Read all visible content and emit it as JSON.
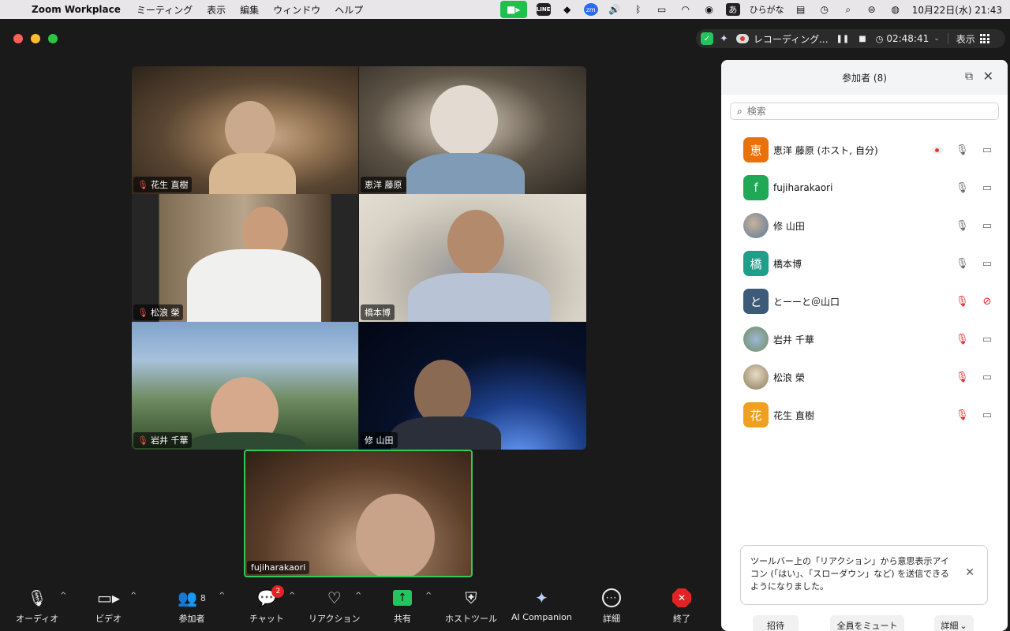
{
  "menubar": {
    "app_name": "Zoom Workplace",
    "menus": [
      "ミーティング",
      "表示",
      "編集",
      "ウィンドウ",
      "ヘルプ"
    ],
    "tray": {
      "line": "LINE",
      "zm": "zm",
      "ime_char": "あ",
      "ime_label": "ひらがな"
    },
    "datetime": "10月22日(水)  21:43"
  },
  "window": {
    "recording_label": "レコーディング...",
    "timer": "02:48:41",
    "view_label": "表示"
  },
  "videos": [
    {
      "name": "花生 直樹",
      "muted": true
    },
    {
      "name": "恵洋 藤原",
      "muted": false
    },
    {
      "name": "松浪 榮",
      "muted": true
    },
    {
      "name": "橋本博",
      "muted": false
    },
    {
      "name": "岩井 千華",
      "muted": true
    },
    {
      "name": "修 山田",
      "muted": false
    },
    {
      "name": "fujiharakaori",
      "muted": false
    }
  ],
  "panel": {
    "title": "参加者 (8)",
    "search_placeholder": "検索",
    "participants": [
      {
        "initial": "恵",
        "name": "恵洋 藤原 (ホスト, 自分)",
        "color": "#e8710a",
        "mic": "on",
        "video": "on",
        "recording": true
      },
      {
        "initial": "f",
        "name": "fujiharakaori",
        "color": "#1fa855",
        "mic": "on",
        "video": "on",
        "recording": false
      },
      {
        "initial": "",
        "name": "修 山田",
        "color": "#5a7a9a",
        "mic": "on",
        "video": "on",
        "recording": false
      },
      {
        "initial": "橋",
        "name": "橋本博",
        "color": "#1f9e8a",
        "mic": "on",
        "video": "on",
        "recording": false
      },
      {
        "initial": "と",
        "name": "とーーと＠山口",
        "color": "#3d5a78",
        "mic": "off",
        "video": "off",
        "recording": false
      },
      {
        "initial": "",
        "name": "岩井 千華",
        "color": "#6e8e5e",
        "mic": "off",
        "video": "on",
        "recording": false
      },
      {
        "initial": "",
        "name": "松浪 榮",
        "color": "#8a7a5a",
        "mic": "off",
        "video": "on",
        "recording": false
      },
      {
        "initial": "花",
        "name": "花生 直樹",
        "color": "#f0a020",
        "mic": "off",
        "video": "on",
        "recording": false
      }
    ],
    "notice": "ツールバー上の「リアクション」から意思表示アイコン (「はい」、「スローダウン」など) を送信できるようになりました。",
    "footer": {
      "invite": "招待",
      "mute_all": "全員をミュート",
      "more": "詳細"
    }
  },
  "toolbar": {
    "audio": "オーディオ",
    "video": "ビデオ",
    "participants": "参加者",
    "participants_count": "8",
    "chat": "チャット",
    "chat_badge": "2",
    "reaction": "リアクション",
    "share": "共有",
    "host_tools": "ホストツール",
    "ai": "AI Companion",
    "more": "詳細",
    "end": "終了"
  }
}
